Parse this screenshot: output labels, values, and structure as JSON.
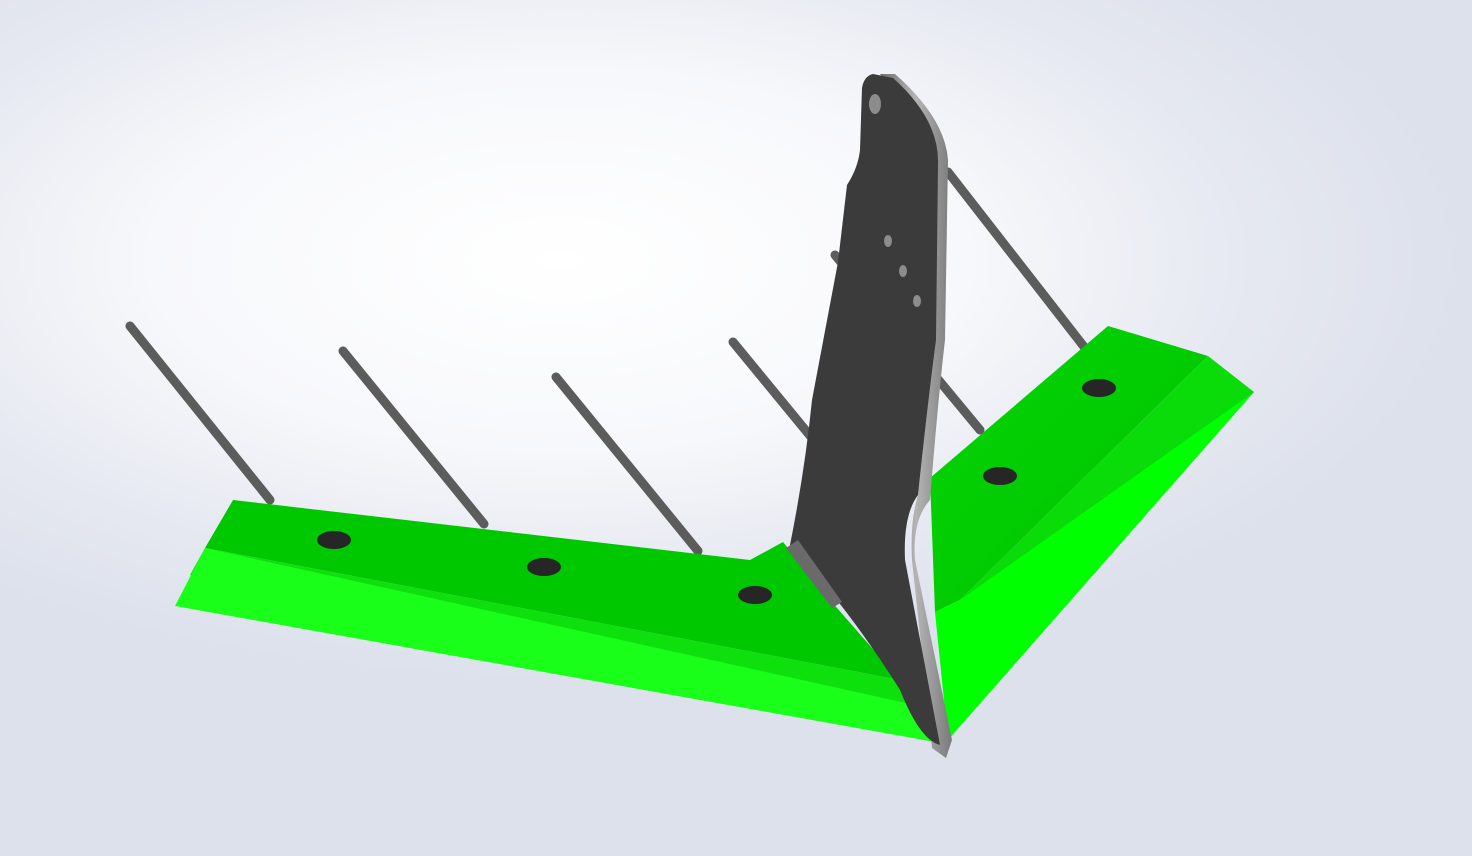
{
  "viewport": {
    "content": "3d-model",
    "colors": {
      "background_light": "#ffffff",
      "background_dark": "#dde1ec",
      "blade_top": "#00c800",
      "blade_front": "#19ff19",
      "blade_bevel": "#0bdc0b",
      "shank_face": "#3a3a3a",
      "shank_edge": "#9a9a9a",
      "tine": "#5a5a5a",
      "bolt_hole": "#262626"
    },
    "model": {
      "left_wing": {
        "bolt_holes": 3
      },
      "right_wing": {
        "bolt_holes": 2
      },
      "shank": {
        "holes": 4
      },
      "tines": 6
    }
  }
}
